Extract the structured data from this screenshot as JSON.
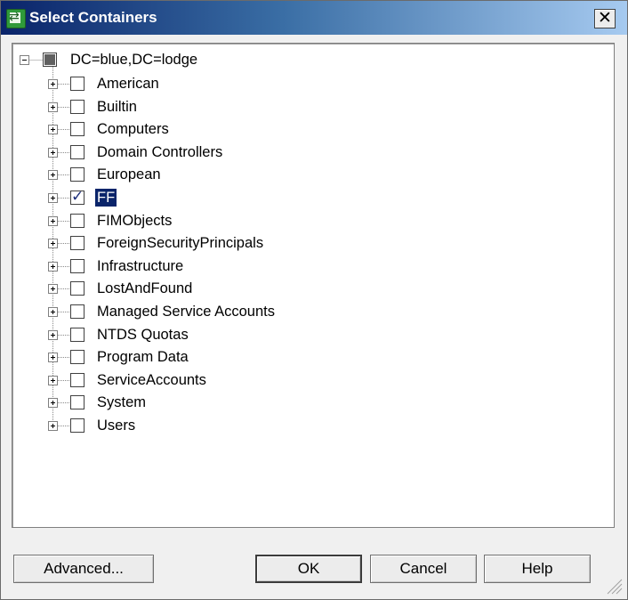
{
  "window": {
    "title": "Select Containers",
    "close_glyph": "✕"
  },
  "tree": {
    "root": {
      "label": "DC=blue,DC=lodge",
      "check_state": "mixed",
      "expanded": true
    },
    "children": [
      {
        "label": "American",
        "checked": false
      },
      {
        "label": "Builtin",
        "checked": false
      },
      {
        "label": "Computers",
        "checked": false
      },
      {
        "label": "Domain Controllers",
        "checked": false
      },
      {
        "label": "European",
        "checked": false
      },
      {
        "label": "FF",
        "checked": true,
        "selected": true
      },
      {
        "label": "FIMObjects",
        "checked": false
      },
      {
        "label": "ForeignSecurityPrincipals",
        "checked": false
      },
      {
        "label": "Infrastructure",
        "checked": false
      },
      {
        "label": "LostAndFound",
        "checked": false
      },
      {
        "label": "Managed Service Accounts",
        "checked": false
      },
      {
        "label": "NTDS Quotas",
        "checked": false
      },
      {
        "label": "Program Data",
        "checked": false
      },
      {
        "label": "ServiceAccounts",
        "checked": false
      },
      {
        "label": "System",
        "checked": false
      },
      {
        "label": "Users",
        "checked": false
      }
    ]
  },
  "buttons": {
    "advanced": "Advanced...",
    "ok": "OK",
    "cancel": "Cancel",
    "help": "Help"
  },
  "colors": {
    "title_gradient_start": "#0a246a",
    "title_gradient_end": "#a6caf0",
    "selection": "#0a246a",
    "check": "#1d2e7a"
  }
}
